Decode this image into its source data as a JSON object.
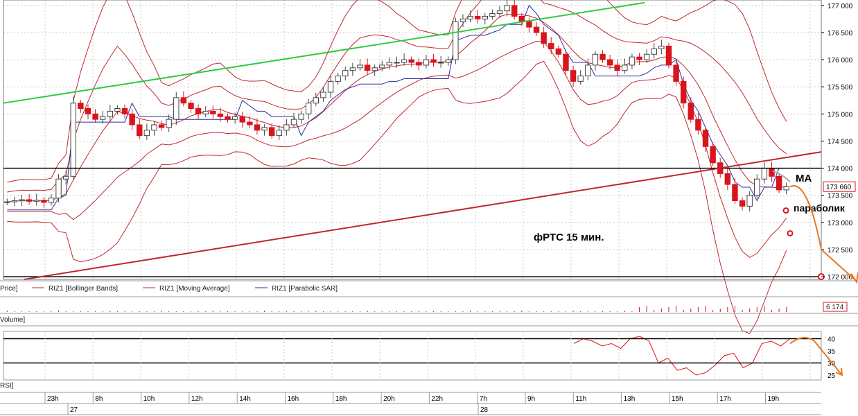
{
  "chart_data": {
    "type": "candlestick",
    "instrument": "фРТС",
    "timeframe": "15 мин.",
    "annotation_title": "фРТС   15 мин.",
    "annotation_ma": "MA",
    "annotation_parabolic": "параболик",
    "price_axis": {
      "ylim": [
        171950,
        177100
      ],
      "ticks": [
        "177 000",
        "176 500",
        "176 000",
        "175 500",
        "175 000",
        "174 500",
        "174 000",
        "173 500",
        "173 000",
        "172 500",
        "172 000"
      ],
      "tick_values": [
        177000,
        176500,
        176000,
        175500,
        175000,
        174500,
        174000,
        173500,
        173000,
        172500,
        172000
      ],
      "last_price_label": "173 660",
      "last_price": 173660,
      "grid": true
    },
    "legend": [
      "Price]",
      "RIZ1 [Bollinger Bands]",
      "RIZ1 [Moving Average]",
      "RIZ1 [Parabolic SAR]"
    ],
    "legend_colors": [
      "#000000",
      "#c0272d",
      "#c0272d",
      "#2b2b9f"
    ],
    "volume_panel": {
      "label": "Volume]",
      "last_label": "6 174",
      "last_value": 6174
    },
    "rsi_panel": {
      "label": "RSI]",
      "ticks": [
        "40",
        "35",
        "30",
        "25"
      ],
      "tick_values": [
        40,
        35,
        30,
        25
      ],
      "levels": [
        40,
        30
      ]
    },
    "time_axis": {
      "hour_labels": [
        "23h",
        "8h",
        "10h",
        "12h",
        "14h",
        "16h",
        "18h",
        "20h",
        "22h",
        "7h",
        "9h",
        "11h",
        "13h",
        "15h",
        "17h",
        "19h"
      ],
      "date_labels": [
        "27",
        "28"
      ]
    },
    "colors": {
      "bull": "#ffffff",
      "bear": "#d8141c",
      "bollinger": "#c0272d",
      "moving_average": "#c0272d",
      "parabolic": "#2b2b9f",
      "upper_trend": "#2ecc40",
      "lower_trend": "#c0272d",
      "forecast": "#e87722",
      "level_line": "#000000"
    },
    "levels": [
      174000,
      172000
    ],
    "upper_trendline": [
      [
        175200,
        0
      ],
      [
        177050,
        1
      ]
    ],
    "lower_trendline": [
      [
        171950,
        0
      ],
      [
        174300,
        1
      ]
    ],
    "close_series": [
      173380,
      173400,
      173420,
      173390,
      173410,
      173370,
      173450,
      173800,
      173850,
      175200,
      175100,
      175000,
      174900,
      174950,
      175050,
      175100,
      175000,
      174800,
      174600,
      174700,
      174800,
      174750,
      174900,
      175300,
      175200,
      175100,
      175000,
      175050,
      175000,
      174950,
      174900,
      174950,
      174850,
      174800,
      174700,
      174750,
      174600,
      174700,
      174800,
      174900,
      175000,
      175200,
      175300,
      175400,
      175600,
      175700,
      175800,
      175850,
      175900,
      175800,
      175850,
      175900,
      175950,
      175950,
      176000,
      175950,
      175900,
      176000,
      175950,
      175950,
      176000,
      176700,
      176750,
      176800,
      176750,
      176800,
      176850,
      176900,
      177000,
      176800,
      176700,
      176600,
      176500,
      176300,
      176200,
      176100,
      175800,
      175600,
      175700,
      175900,
      176100,
      176000,
      175900,
      175800,
      175900,
      176050,
      176000,
      176100,
      176200,
      176250,
      175900,
      175600,
      175200,
      174900,
      174700,
      174400,
      174100,
      173900,
      173700,
      173400,
      173300,
      173500,
      173800,
      174000,
      173850,
      173600,
      173660
    ],
    "forecast_price": [
      [
        173660,
        0
      ],
      [
        172500,
        0.6
      ],
      [
        171800,
        1
      ]
    ],
    "parabolic_points": [
      173220,
      172800
    ],
    "rsi_series": [
      38,
      40,
      39,
      37,
      38,
      36,
      40,
      41,
      39,
      30,
      32,
      27,
      28,
      25,
      26,
      29,
      33,
      34,
      28,
      30,
      38,
      39,
      37,
      40
    ],
    "rsi_forecast": [
      [
        38,
        0
      ],
      [
        40,
        0.3
      ],
      [
        25,
        1
      ]
    ]
  }
}
